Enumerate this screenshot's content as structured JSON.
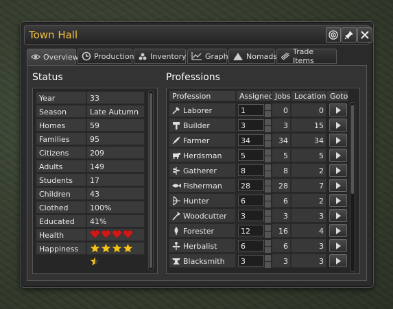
{
  "window": {
    "title": "Town Hall"
  },
  "tabs": [
    {
      "label": "Overview",
      "icon": "eye-icon",
      "active": true
    },
    {
      "label": "Production",
      "icon": "production-icon",
      "active": false
    },
    {
      "label": "Inventory",
      "icon": "inventory-icon",
      "active": false
    },
    {
      "label": "Graphs",
      "icon": "graph-icon",
      "active": false
    },
    {
      "label": "Nomads",
      "icon": "tent-icon",
      "active": false
    },
    {
      "label": "Trade Items",
      "icon": "trade-icon",
      "active": false
    }
  ],
  "status": {
    "heading": "Status",
    "rows": [
      {
        "label": "Year",
        "value": "33"
      },
      {
        "label": "Season",
        "value": "Late Autumn"
      },
      {
        "label": "Homes",
        "value": "59"
      },
      {
        "label": "Families",
        "value": "95"
      },
      {
        "label": "Citizens",
        "value": "209"
      },
      {
        "label": "Adults",
        "value": "149"
      },
      {
        "label": "Students",
        "value": "17"
      },
      {
        "label": "Children",
        "value": "43"
      },
      {
        "label": "Clothed",
        "value": "100%"
      },
      {
        "label": "Educated",
        "value": "41%"
      },
      {
        "label": "Health",
        "value": ""
      },
      {
        "label": "Happiness",
        "value": ""
      }
    ],
    "health_hearts": 4.5,
    "happiness_stars": 4.5
  },
  "professions": {
    "heading": "Professions",
    "columns": [
      "Profession",
      "Assigned",
      "Jobs",
      "Locations",
      "Goto"
    ],
    "rows": [
      {
        "name": "Laborer",
        "icon": "shovel-icon",
        "assigned": "1",
        "jobs": "0",
        "locations": "0"
      },
      {
        "name": "Builder",
        "icon": "hammer-icon",
        "assigned": "3",
        "jobs": "3",
        "locations": "15"
      },
      {
        "name": "Farmer",
        "icon": "wheat-icon",
        "assigned": "34",
        "jobs": "34",
        "locations": "34"
      },
      {
        "name": "Herdsman",
        "icon": "cow-icon",
        "assigned": "5",
        "jobs": "5",
        "locations": "5"
      },
      {
        "name": "Gatherer",
        "icon": "herb-icon",
        "assigned": "8",
        "jobs": "8",
        "locations": "2"
      },
      {
        "name": "Fisherman",
        "icon": "fish-icon",
        "assigned": "28",
        "jobs": "28",
        "locations": "7"
      },
      {
        "name": "Hunter",
        "icon": "bow-icon",
        "assigned": "6",
        "jobs": "6",
        "locations": "2"
      },
      {
        "name": "Woodcutter",
        "icon": "axe-icon",
        "assigned": "3",
        "jobs": "3",
        "locations": "3"
      },
      {
        "name": "Forester",
        "icon": "sapling-icon",
        "assigned": "12",
        "jobs": "16",
        "locations": "4"
      },
      {
        "name": "Herbalist",
        "icon": "herbalist-icon",
        "assigned": "6",
        "jobs": "6",
        "locations": "3"
      },
      {
        "name": "Blacksmith",
        "icon": "anvil-icon",
        "assigned": "3",
        "jobs": "3",
        "locations": "3"
      }
    ]
  },
  "colors": {
    "title": "#f0c040",
    "heart": "#d01818",
    "star": "#f5c518"
  }
}
